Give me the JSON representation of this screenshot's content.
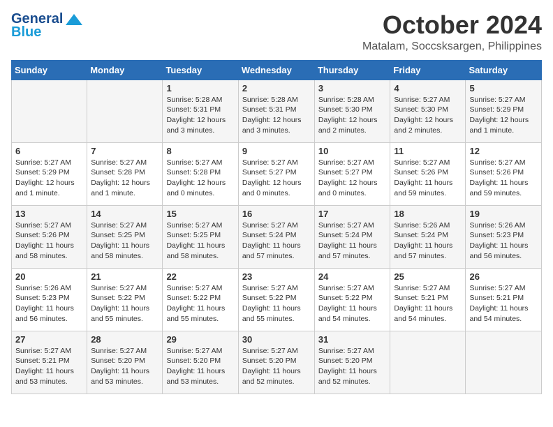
{
  "header": {
    "logo_line1": "General",
    "logo_line2": "Blue",
    "month": "October 2024",
    "location": "Matalam, Soccsksargen, Philippines"
  },
  "days_of_week": [
    "Sunday",
    "Monday",
    "Tuesday",
    "Wednesday",
    "Thursday",
    "Friday",
    "Saturday"
  ],
  "weeks": [
    [
      {
        "day": "",
        "info": ""
      },
      {
        "day": "",
        "info": ""
      },
      {
        "day": "1",
        "info": "Sunrise: 5:28 AM\nSunset: 5:31 PM\nDaylight: 12 hours and 3 minutes."
      },
      {
        "day": "2",
        "info": "Sunrise: 5:28 AM\nSunset: 5:31 PM\nDaylight: 12 hours and 3 minutes."
      },
      {
        "day": "3",
        "info": "Sunrise: 5:28 AM\nSunset: 5:30 PM\nDaylight: 12 hours and 2 minutes."
      },
      {
        "day": "4",
        "info": "Sunrise: 5:27 AM\nSunset: 5:30 PM\nDaylight: 12 hours and 2 minutes."
      },
      {
        "day": "5",
        "info": "Sunrise: 5:27 AM\nSunset: 5:29 PM\nDaylight: 12 hours and 1 minute."
      }
    ],
    [
      {
        "day": "6",
        "info": "Sunrise: 5:27 AM\nSunset: 5:29 PM\nDaylight: 12 hours and 1 minute."
      },
      {
        "day": "7",
        "info": "Sunrise: 5:27 AM\nSunset: 5:28 PM\nDaylight: 12 hours and 1 minute."
      },
      {
        "day": "8",
        "info": "Sunrise: 5:27 AM\nSunset: 5:28 PM\nDaylight: 12 hours and 0 minutes."
      },
      {
        "day": "9",
        "info": "Sunrise: 5:27 AM\nSunset: 5:27 PM\nDaylight: 12 hours and 0 minutes."
      },
      {
        "day": "10",
        "info": "Sunrise: 5:27 AM\nSunset: 5:27 PM\nDaylight: 12 hours and 0 minutes."
      },
      {
        "day": "11",
        "info": "Sunrise: 5:27 AM\nSunset: 5:26 PM\nDaylight: 11 hours and 59 minutes."
      },
      {
        "day": "12",
        "info": "Sunrise: 5:27 AM\nSunset: 5:26 PM\nDaylight: 11 hours and 59 minutes."
      }
    ],
    [
      {
        "day": "13",
        "info": "Sunrise: 5:27 AM\nSunset: 5:26 PM\nDaylight: 11 hours and 58 minutes."
      },
      {
        "day": "14",
        "info": "Sunrise: 5:27 AM\nSunset: 5:25 PM\nDaylight: 11 hours and 58 minutes."
      },
      {
        "day": "15",
        "info": "Sunrise: 5:27 AM\nSunset: 5:25 PM\nDaylight: 11 hours and 58 minutes."
      },
      {
        "day": "16",
        "info": "Sunrise: 5:27 AM\nSunset: 5:24 PM\nDaylight: 11 hours and 57 minutes."
      },
      {
        "day": "17",
        "info": "Sunrise: 5:27 AM\nSunset: 5:24 PM\nDaylight: 11 hours and 57 minutes."
      },
      {
        "day": "18",
        "info": "Sunrise: 5:26 AM\nSunset: 5:24 PM\nDaylight: 11 hours and 57 minutes."
      },
      {
        "day": "19",
        "info": "Sunrise: 5:26 AM\nSunset: 5:23 PM\nDaylight: 11 hours and 56 minutes."
      }
    ],
    [
      {
        "day": "20",
        "info": "Sunrise: 5:26 AM\nSunset: 5:23 PM\nDaylight: 11 hours and 56 minutes."
      },
      {
        "day": "21",
        "info": "Sunrise: 5:27 AM\nSunset: 5:22 PM\nDaylight: 11 hours and 55 minutes."
      },
      {
        "day": "22",
        "info": "Sunrise: 5:27 AM\nSunset: 5:22 PM\nDaylight: 11 hours and 55 minutes."
      },
      {
        "day": "23",
        "info": "Sunrise: 5:27 AM\nSunset: 5:22 PM\nDaylight: 11 hours and 55 minutes."
      },
      {
        "day": "24",
        "info": "Sunrise: 5:27 AM\nSunset: 5:22 PM\nDaylight: 11 hours and 54 minutes."
      },
      {
        "day": "25",
        "info": "Sunrise: 5:27 AM\nSunset: 5:21 PM\nDaylight: 11 hours and 54 minutes."
      },
      {
        "day": "26",
        "info": "Sunrise: 5:27 AM\nSunset: 5:21 PM\nDaylight: 11 hours and 54 minutes."
      }
    ],
    [
      {
        "day": "27",
        "info": "Sunrise: 5:27 AM\nSunset: 5:21 PM\nDaylight: 11 hours and 53 minutes."
      },
      {
        "day": "28",
        "info": "Sunrise: 5:27 AM\nSunset: 5:20 PM\nDaylight: 11 hours and 53 minutes."
      },
      {
        "day": "29",
        "info": "Sunrise: 5:27 AM\nSunset: 5:20 PM\nDaylight: 11 hours and 53 minutes."
      },
      {
        "day": "30",
        "info": "Sunrise: 5:27 AM\nSunset: 5:20 PM\nDaylight: 11 hours and 52 minutes."
      },
      {
        "day": "31",
        "info": "Sunrise: 5:27 AM\nSunset: 5:20 PM\nDaylight: 11 hours and 52 minutes."
      },
      {
        "day": "",
        "info": ""
      },
      {
        "day": "",
        "info": ""
      }
    ]
  ]
}
